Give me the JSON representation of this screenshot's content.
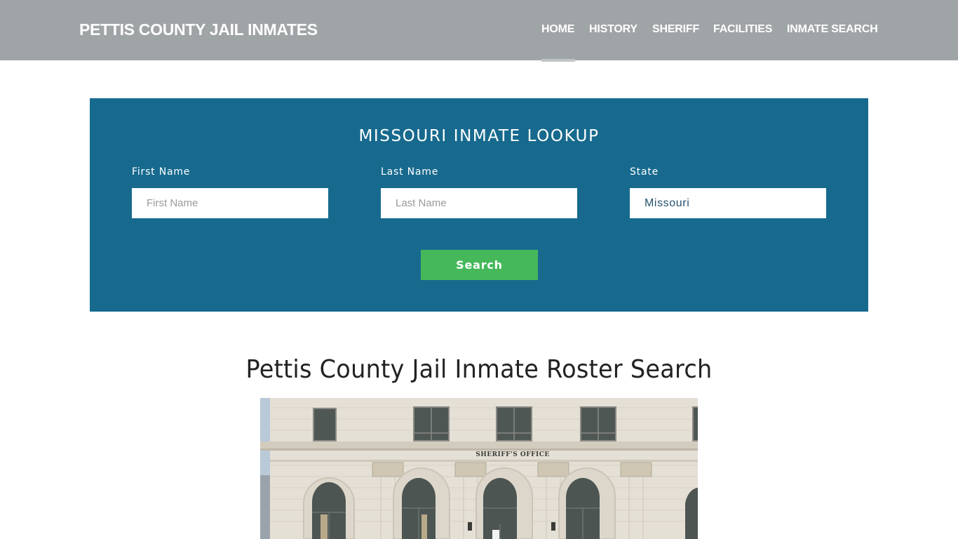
{
  "header": {
    "brand": "PETTIS COUNTY JAIL INMATES",
    "nav": [
      {
        "label": "HOME",
        "active": true
      },
      {
        "label": "HISTORY",
        "active": false
      },
      {
        "label": "SHERIFF",
        "active": false
      },
      {
        "label": "FACILITIES",
        "active": false
      },
      {
        "label": "INMATE SEARCH",
        "active": false
      }
    ],
    "colors": {
      "background": "#9fa4a7",
      "text": "#ffffff",
      "active_underline": "#c2c5c7"
    }
  },
  "lookup": {
    "title": "MISSOURI INMATE LOOKUP",
    "fields": {
      "first_name": {
        "label": "First Name",
        "placeholder": "First Name",
        "value": ""
      },
      "last_name": {
        "label": "Last Name",
        "placeholder": "Last Name",
        "value": ""
      },
      "state": {
        "label": "State",
        "value": "Missouri"
      }
    },
    "search_button": "Search",
    "colors": {
      "panel": "#176a8e",
      "button": "#45b85a"
    }
  },
  "main": {
    "heading": "Pettis County Jail Inmate Roster Search",
    "image": {
      "alt": "Pettis County Sheriff's Office building facade",
      "sign_text": "SHERIFF'S OFFICE"
    }
  }
}
